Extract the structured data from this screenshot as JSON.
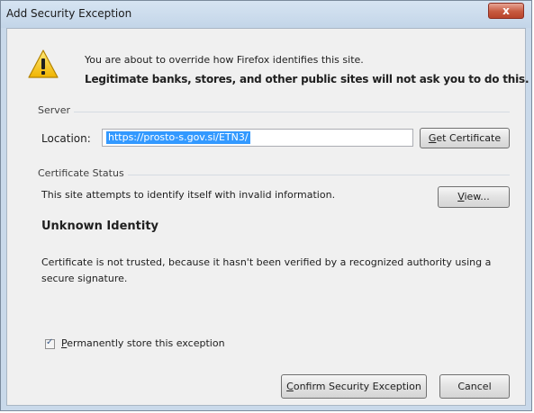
{
  "window": {
    "title": "Add Security Exception",
    "close_glyph": "x"
  },
  "intro": {
    "line1": "You are about to override how Firefox identifies this site.",
    "line2": "Legitimate banks, stores, and other public sites will not ask you to do this.",
    "icon": "warning-icon"
  },
  "server": {
    "group_label": "Server",
    "location_label": "Location:",
    "location_value": "https://prosto-s.gov.si/ETN3/",
    "get_certificate_prefix": "",
    "get_certificate_accel": "G",
    "get_certificate_rest": "et Certificate"
  },
  "certificate_status": {
    "group_label": "Certificate Status",
    "status_text": "This site attempts to identify itself with invalid information.",
    "view_accel": "V",
    "view_rest": "iew...",
    "heading": "Unknown Identity",
    "detail": "Certificate is not trusted, because it hasn't been verified by a recognized authority using a secure signature."
  },
  "permanent": {
    "checked": true,
    "check_glyph": "✓",
    "label_accel": "P",
    "label_rest": "ermanently store this exception"
  },
  "buttons": {
    "confirm_accel": "C",
    "confirm_rest": "onfirm Security Exception",
    "cancel_label": "Cancel"
  }
}
